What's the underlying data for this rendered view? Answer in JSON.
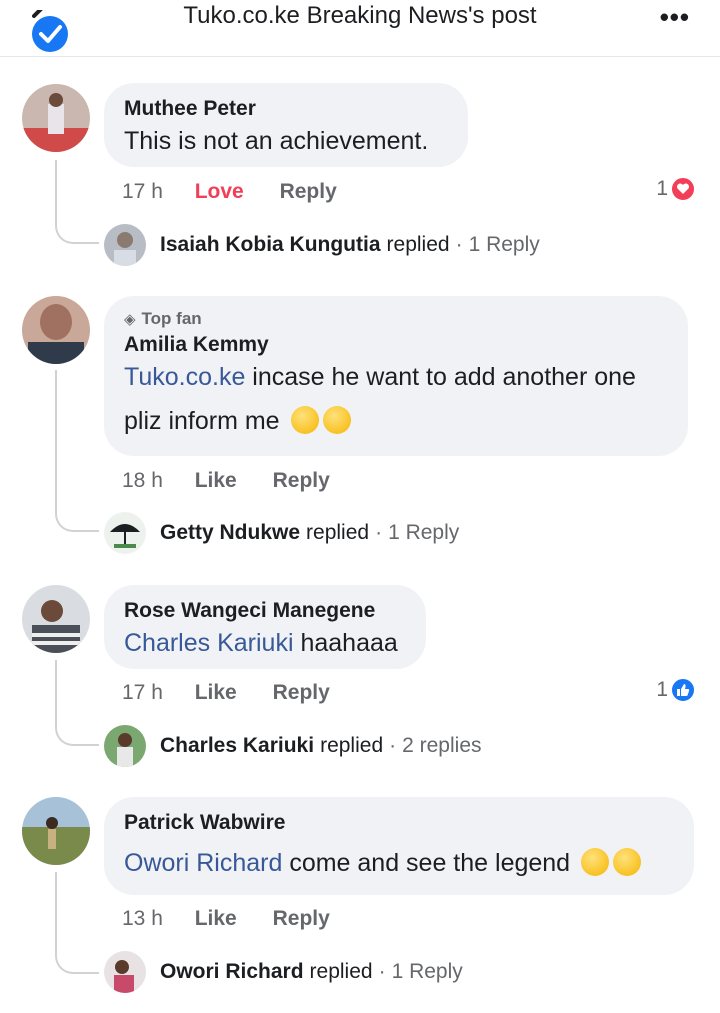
{
  "header": {
    "title": "Tuko.co.ke Breaking News's post",
    "more_label": "•••",
    "badge_color": "#1877f2"
  },
  "comments": [
    {
      "author": "Muthee Peter",
      "text": "This is not an achievement.",
      "time": "17 h",
      "reaction_action": "Love",
      "reply_action": "Reply",
      "reaction_count": "1",
      "reaction_icon": "heart-icon",
      "reply_author": "Isaiah Kobia Kungutia",
      "reply_verb": "replied",
      "reply_count": "1 Reply"
    },
    {
      "badge": "Top fan",
      "author": "Amilia Kemmy",
      "mention": "Tuko.co.ke",
      "text_line1": " incase he want to add another one",
      "text_line2": "pliz inform me",
      "time": "18 h",
      "reaction_action": "Like",
      "reply_action": "Reply",
      "reply_author": "Getty Ndukwe",
      "reply_verb": "replied",
      "reply_count": "1 Reply"
    },
    {
      "author": "Rose Wangeci Manegene",
      "mention": "Charles Kariuki",
      "text": " haahaaa",
      "time": "17 h",
      "reaction_action": "Like",
      "reply_action": "Reply",
      "reaction_count": "1",
      "reaction_icon": "like-icon",
      "reply_author": "Charles Kariuki",
      "reply_verb": "replied",
      "reply_count": "2 replies"
    },
    {
      "author": "Patrick Wabwire",
      "mention": "Owori Richard",
      "text": " come and see the legend",
      "time": "13 h",
      "reaction_action": "Like",
      "reply_action": "Reply",
      "reply_author": "Owori Richard",
      "reply_verb": "replied",
      "reply_count": "1 Reply"
    }
  ],
  "colors": {
    "mention": "#385898",
    "love": "#f33e58",
    "like": "#1877f2",
    "bubble": "#f0f2f5"
  }
}
